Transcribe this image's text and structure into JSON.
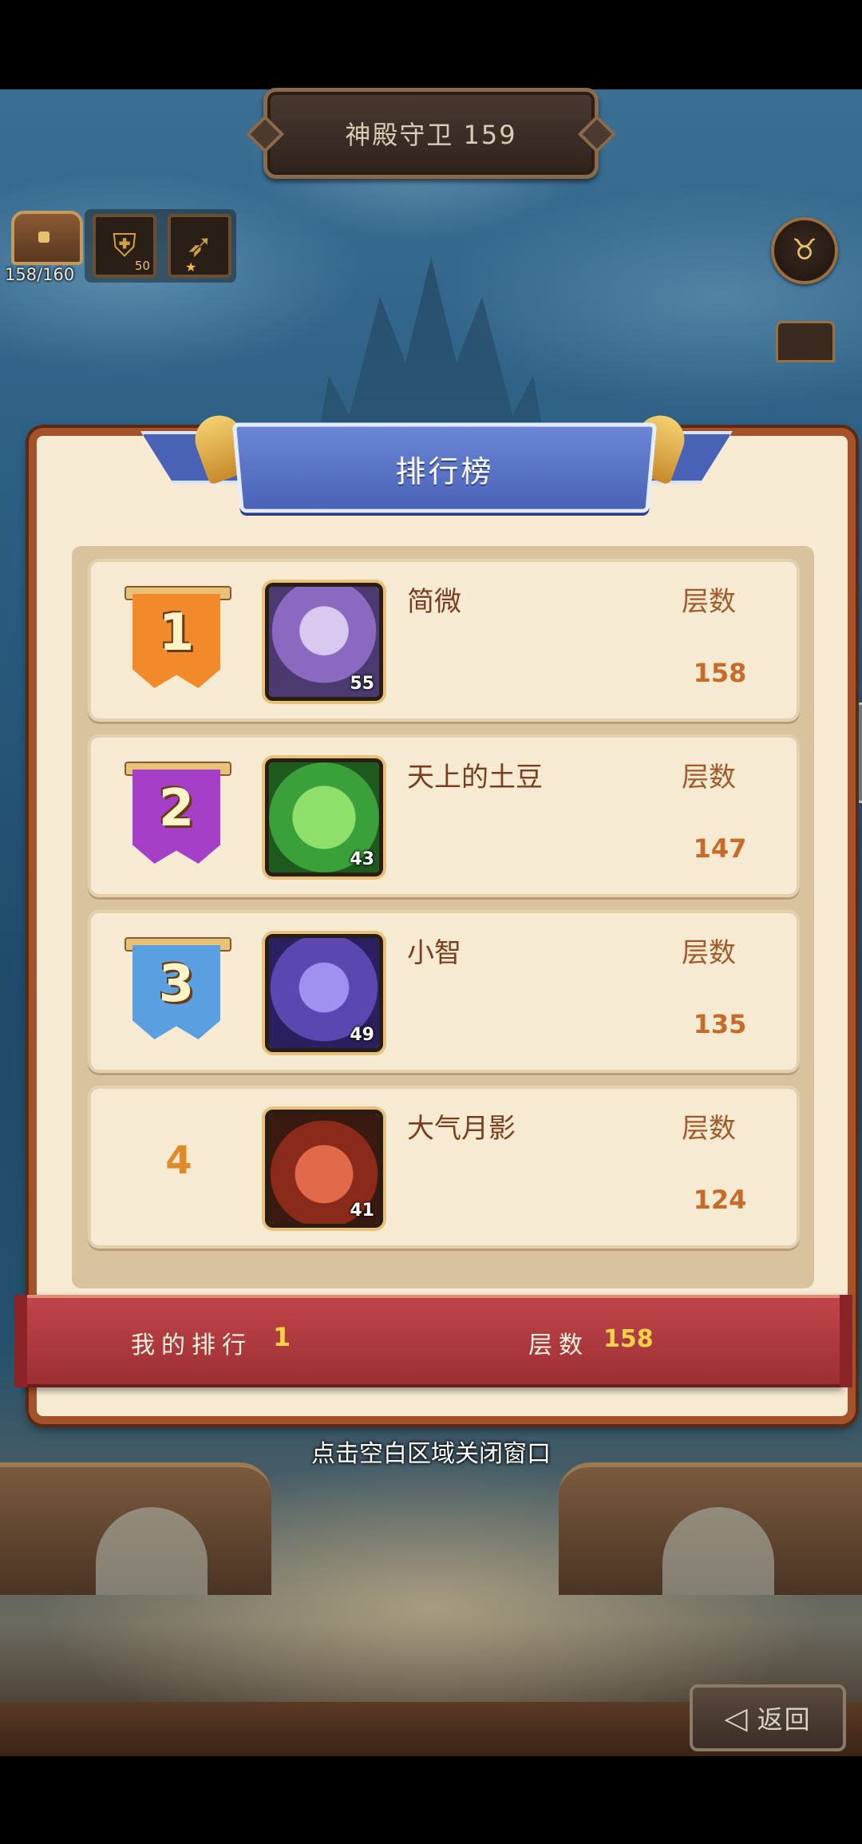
{
  "title": "神殿守卫 159",
  "resources": {
    "chest_count": "158/160",
    "slot1_level": "50"
  },
  "leaderboard": {
    "header": "排行榜",
    "rows": [
      {
        "rank": "1",
        "name": "简微",
        "level": "55",
        "floor_label": "层数",
        "floor": "158",
        "medal_color": "#f2892a"
      },
      {
        "rank": "2",
        "name": "天上的土豆",
        "level": "43",
        "floor_label": "层数",
        "floor": "147",
        "medal_color": "#a63fc8"
      },
      {
        "rank": "3",
        "name": "小智",
        "level": "49",
        "floor_label": "层数",
        "floor": "135",
        "medal_color": "#5aa0e0"
      },
      {
        "rank": "4",
        "name": "大气月影",
        "level": "41",
        "floor_label": "层数",
        "floor": "124"
      }
    ]
  },
  "my_rank": {
    "label": "我的排行",
    "value": "1",
    "floor_label": "层数",
    "floor_value": "158"
  },
  "close_hint": "点击空白区域关闭窗口",
  "back_button": {
    "label": "返回",
    "icon": "back-arrow-icon"
  },
  "colors": {
    "panel_border": "#a4522a",
    "ribbon_blue": "#4a62b6",
    "footer_red": "#b33a3f",
    "gold": "#ffd24a"
  }
}
